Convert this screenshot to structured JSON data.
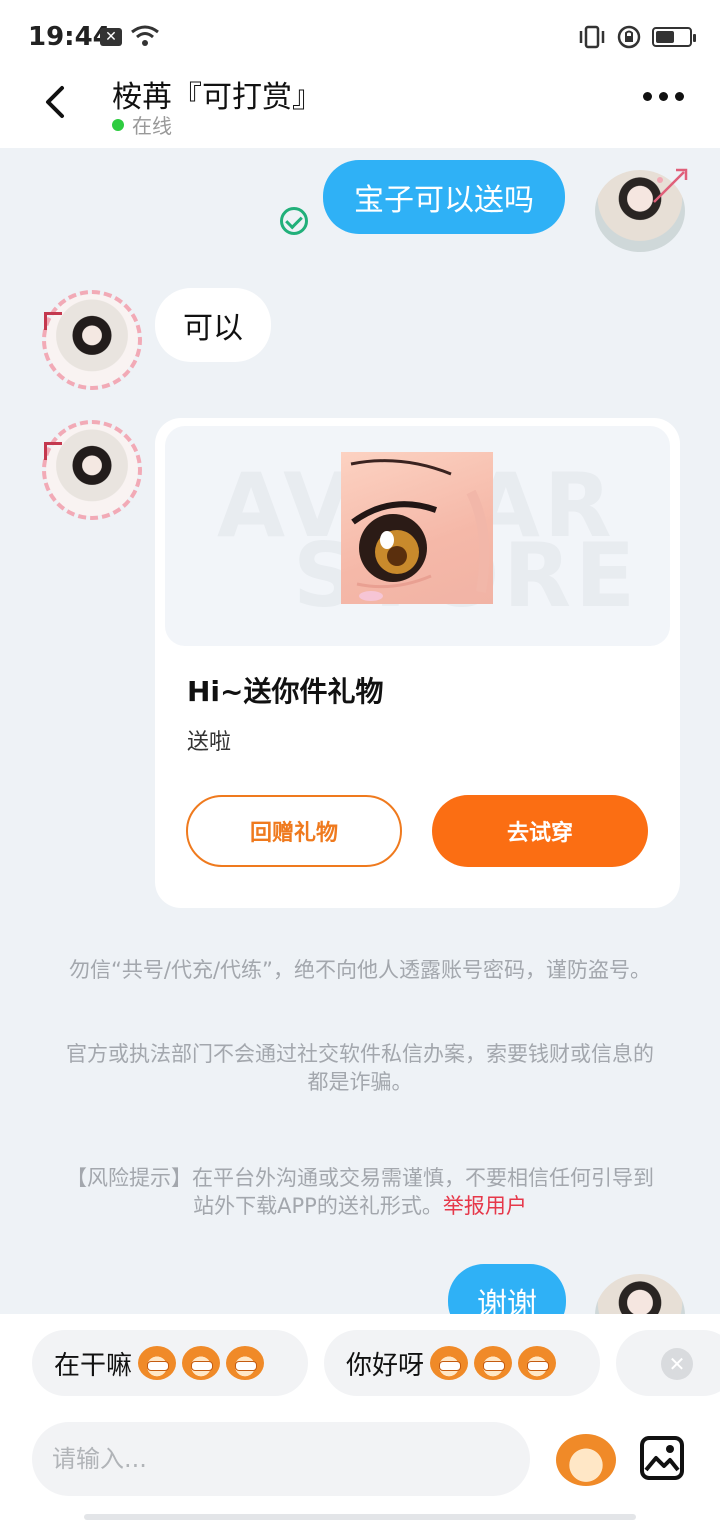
{
  "status_bar": {
    "time": "19:44",
    "x_icon": "notification-x-icon",
    "wifi": "wifi-icon",
    "battery_level": 0.55
  },
  "header": {
    "back_icon": "chevron-left-icon",
    "name": "桉苒『可打赏』",
    "status": "在线",
    "more_icon": "more-dots-icon"
  },
  "messages": {
    "out1": "宝子可以送吗",
    "in1": "可以",
    "gift_card": {
      "watermark_line1": "AVATAR",
      "watermark_line2": "STORE",
      "title": "Hi~送你件礼物",
      "subtitle": "送啦",
      "btn_return": "回赠礼物",
      "btn_try": "去试穿"
    },
    "out2": "谢谢"
  },
  "notices": {
    "n1": "勿信“共号/代充/代练”，绝不向他人透露账号密码，谨防盗号。",
    "n2": "官方或执法部门不会通过社交软件私信办案，索要钱财或信息的都是诈骗。",
    "n3": "【风险提示】在平台外沟通或交易需谨慎，不要相信任何引导到站外下载APP的送礼形式。",
    "report": "举报用户"
  },
  "quick_replies": [
    {
      "text": "在干嘛"
    },
    {
      "text": "你好呀"
    }
  ],
  "input": {
    "placeholder": "请输入..."
  },
  "colors": {
    "bubble_out": "#2fb1f6",
    "primary_orange": "#fb6e13",
    "online_dot": "#2ecc40",
    "report": "#e6384a"
  }
}
